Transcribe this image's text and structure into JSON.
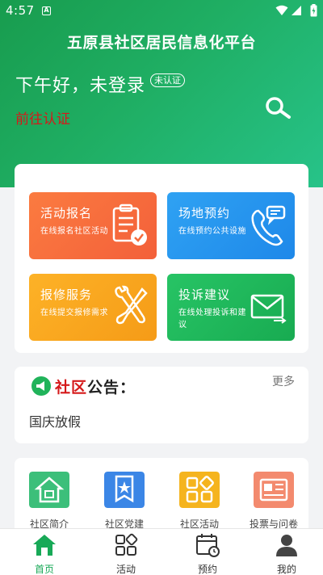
{
  "status_bar": {
    "time": "4:57",
    "app_icon_letter": "A"
  },
  "header": {
    "title": "五原县社区居民信息化平台",
    "greeting": "下午好，未登录",
    "auth_badge": "未认证",
    "go_auth_link": "前往认证",
    "search_icon": "search-icon"
  },
  "services": [
    {
      "title": "活动报名",
      "subtitle": "在线报名社区活动",
      "icon": "clipboard-check-icon",
      "color": "#f56b3b"
    },
    {
      "title": "场地预约",
      "subtitle": "在线预约公共设施",
      "icon": "phone-message-icon",
      "color": "#2396ee"
    },
    {
      "title": "报修服务",
      "subtitle": "在线提交报修需求",
      "icon": "tools-icon",
      "color": "#f8a81f"
    },
    {
      "title": "投诉建议",
      "subtitle": "在线处理投诉和建议",
      "icon": "envelope-icon",
      "color": "#1fb85b"
    }
  ],
  "notice": {
    "heading_red": "社区",
    "heading_black": "公告：",
    "more": "更多",
    "text": "国庆放假"
  },
  "shortcuts": [
    {
      "label": "社区简介",
      "icon": "house-icon",
      "color": "#3cbf7a"
    },
    {
      "label": "社区党建",
      "icon": "party-badge-icon",
      "color": "#3b86e6"
    },
    {
      "label": "社区活动",
      "icon": "grid-shapes-icon",
      "color": "#f5b41e"
    },
    {
      "label": "投票与问卷",
      "icon": "newspaper-icon",
      "color": "#f38a6e"
    }
  ],
  "tabs": [
    {
      "label": "首页",
      "icon": "home-icon",
      "active": true
    },
    {
      "label": "活动",
      "icon": "activity-grid-icon",
      "active": false
    },
    {
      "label": "预约",
      "icon": "calendar-clock-icon",
      "active": false
    },
    {
      "label": "我的",
      "icon": "person-icon",
      "active": false
    }
  ],
  "colors": {
    "brand_green": "#1fae63",
    "accent_red": "#d5191a",
    "tab_active": "#18a957"
  }
}
